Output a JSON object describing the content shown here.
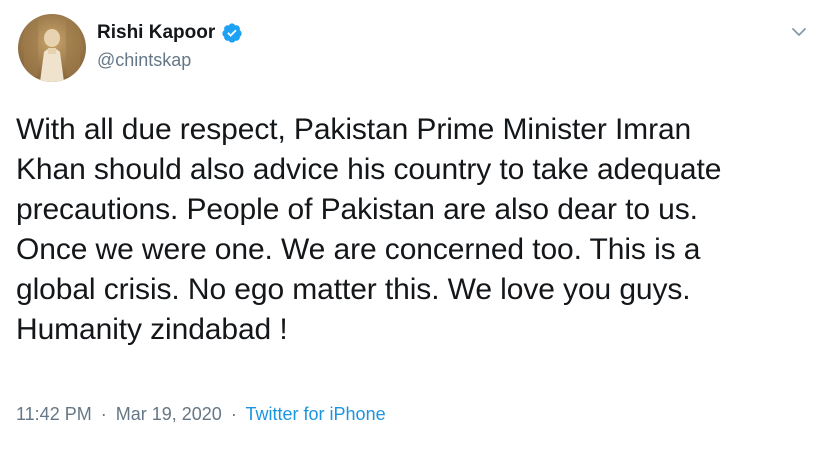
{
  "tweet": {
    "author": {
      "display_name": "Rishi Kapoor",
      "handle": "@chintskap",
      "verified": true,
      "verified_icon": "verified-badge-icon",
      "avatar_icon": "profile-avatar"
    },
    "menu_icon": "chevron-down-icon",
    "text": "With all due respect, Pakistan Prime Minister Imran\nKhan should also advice his country to take adequate\nprecautions. People of Pakistan are also dear to us.\nOnce we were one. We are concerned too. This is a\nglobal crisis. No ego matter this. We love you guys.\nHumanity zindabad !",
    "time": "11:42 PM",
    "separator": "·",
    "date": "Mar 19, 2020",
    "source": "Twitter for iPhone"
  },
  "colors": {
    "text": "#14171a",
    "secondary": "#657786",
    "link": "#1b95e0",
    "verified": "#1da1f2"
  }
}
